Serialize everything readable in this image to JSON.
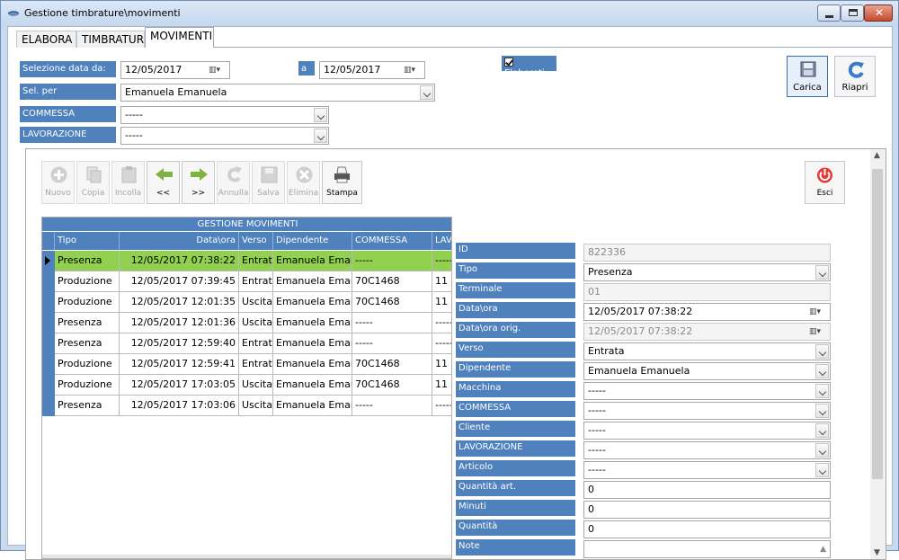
{
  "window": {
    "title": "Gestione timbrature\\movimenti"
  },
  "tabs": [
    "ELABORA",
    "TIMBRATURE",
    "MOVIMENTI"
  ],
  "filters": {
    "date_from_label": "Selezione data da:",
    "date_from": "12/05/2017",
    "date_to_label": "a",
    "date_to": "12/05/2017",
    "elaborati_label": "Elaborati",
    "employee_label": "Sel. per dipendente:",
    "employee": "Emanuela Emanuela",
    "commessa_label": "COMMESSA",
    "commessa": "-----",
    "lavorazione_label": "LAVORAZIONE",
    "lavorazione": "-----"
  },
  "actions": {
    "carica": "Carica",
    "riapri": "Riapri"
  },
  "toolbar": {
    "nuovo": "Nuovo",
    "copia": "Copia",
    "incolla": "Incolla",
    "prev": "<<",
    "next": ">>",
    "annulla": "Annulla",
    "salva": "Salva",
    "elimina": "Elimina",
    "stampa": "Stampa",
    "esci": "Esci"
  },
  "grid": {
    "title": "GESTIONE MOVIMENTI",
    "columns": [
      "Tipo",
      "Data\\ora",
      "Verso",
      "Dipendente",
      "COMMESSA",
      "LAV"
    ],
    "rows": [
      [
        "Presenza",
        "12/05/2017 07:38:22",
        "Entrat",
        "Emanuela Emanu",
        "-----",
        "-----"
      ],
      [
        "Produzione",
        "12/05/2017 07:39:45",
        "Entrat",
        "Emanuela Emanu",
        "70C1468",
        "11"
      ],
      [
        "Produzione",
        "12/05/2017 12:01:35",
        "Uscita",
        "Emanuela Emanu",
        "70C1468",
        "11"
      ],
      [
        "Presenza",
        "12/05/2017 12:01:36",
        "Uscita",
        "Emanuela Emanu",
        "-----",
        "-----"
      ],
      [
        "Presenza",
        "12/05/2017 12:59:40",
        "Entrat",
        "Emanuela Emanu",
        "-----",
        "-----"
      ],
      [
        "Produzione",
        "12/05/2017 12:59:41",
        "Entrat",
        "Emanuela Emanu",
        "70C1468",
        "11"
      ],
      [
        "Produzione",
        "12/05/2017 17:03:05",
        "Uscita",
        "Emanuela Emanu",
        "70C1468",
        "11"
      ],
      [
        "Presenza",
        "12/05/2017 17:03:06",
        "Uscita",
        "Emanuela Emanu",
        "-----",
        "-----"
      ]
    ]
  },
  "detail": {
    "id_label": "ID",
    "id": "822336",
    "tipo_label": "Tipo",
    "tipo": "Presenza",
    "terminale_label": "Terminale",
    "terminale": "01",
    "dataora_label": "Data\\ora",
    "dataora": "12/05/2017 07:38:22",
    "dataora_orig_label": "Data\\ora orig.",
    "dataora_orig": "12/05/2017 07:38:22",
    "verso_label": "Verso",
    "verso": "Entrata",
    "dipendente_label": "Dipendente",
    "dipendente": "Emanuela Emanuela",
    "macchina_label": "Macchina",
    "macchina": "-----",
    "commessa_label": "COMMESSA",
    "commessa": "-----",
    "cliente_label": "Cliente",
    "cliente": "-----",
    "lavorazione_label": "LAVORAZIONE",
    "lavorazione": "-----",
    "articolo_label": "Articolo",
    "articolo": "-----",
    "quantita_art_label": "Quantità art.",
    "quantita_art": "0",
    "minuti_label": "Minuti",
    "minuti": "0",
    "quantita_label": "Quantità",
    "quantita": "0",
    "note_label": "Note",
    "note": ""
  },
  "colors": {
    "label_bg": "#4f81bd",
    "selected_row": "#92d050"
  }
}
